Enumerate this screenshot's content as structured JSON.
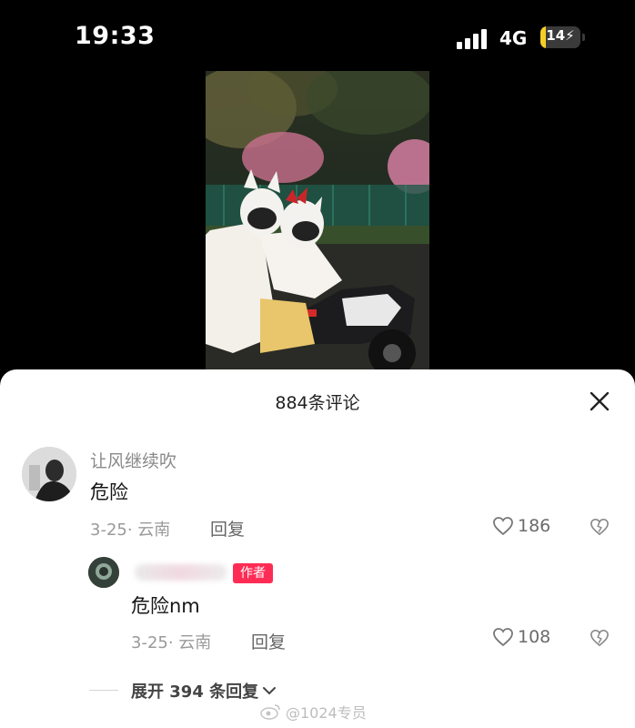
{
  "status_bar": {
    "time": "19:33",
    "network": "4G",
    "battery": "14",
    "battery_level": 0.14
  },
  "sheet": {
    "title": "884条评论"
  },
  "comment": {
    "username": "让风继续吹",
    "text": "危险",
    "meta": "3-25· 云南",
    "reply_label": "回复",
    "likes": "186"
  },
  "reply": {
    "badge": "作者",
    "text": "危险nm",
    "meta": "3-25· 云南",
    "reply_label": "回复",
    "likes": "108"
  },
  "expand": {
    "label": "展开 394 条回复"
  },
  "watermark": "@1024专员"
}
